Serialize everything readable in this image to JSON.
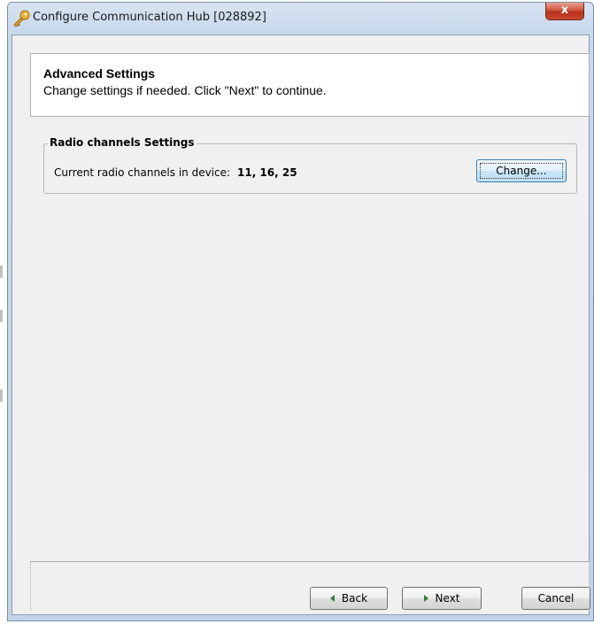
{
  "window": {
    "title": "Configure Communication Hub [028892]",
    "icon": "key-icon",
    "close_label": "x"
  },
  "header": {
    "title": "Advanced Settings",
    "subtitle": "Change settings if needed. Click \"Next\" to continue."
  },
  "radio_group": {
    "legend": "Radio channels Settings",
    "label": "Current radio channels in device:",
    "value": "11, 16, 25",
    "change_label": "Change..."
  },
  "footer": {
    "back_label": "Back",
    "next_label": "Next",
    "cancel_label": "Cancel"
  },
  "colors": {
    "accent_arrow": "#2e7d32",
    "close_button": "#c84830"
  }
}
